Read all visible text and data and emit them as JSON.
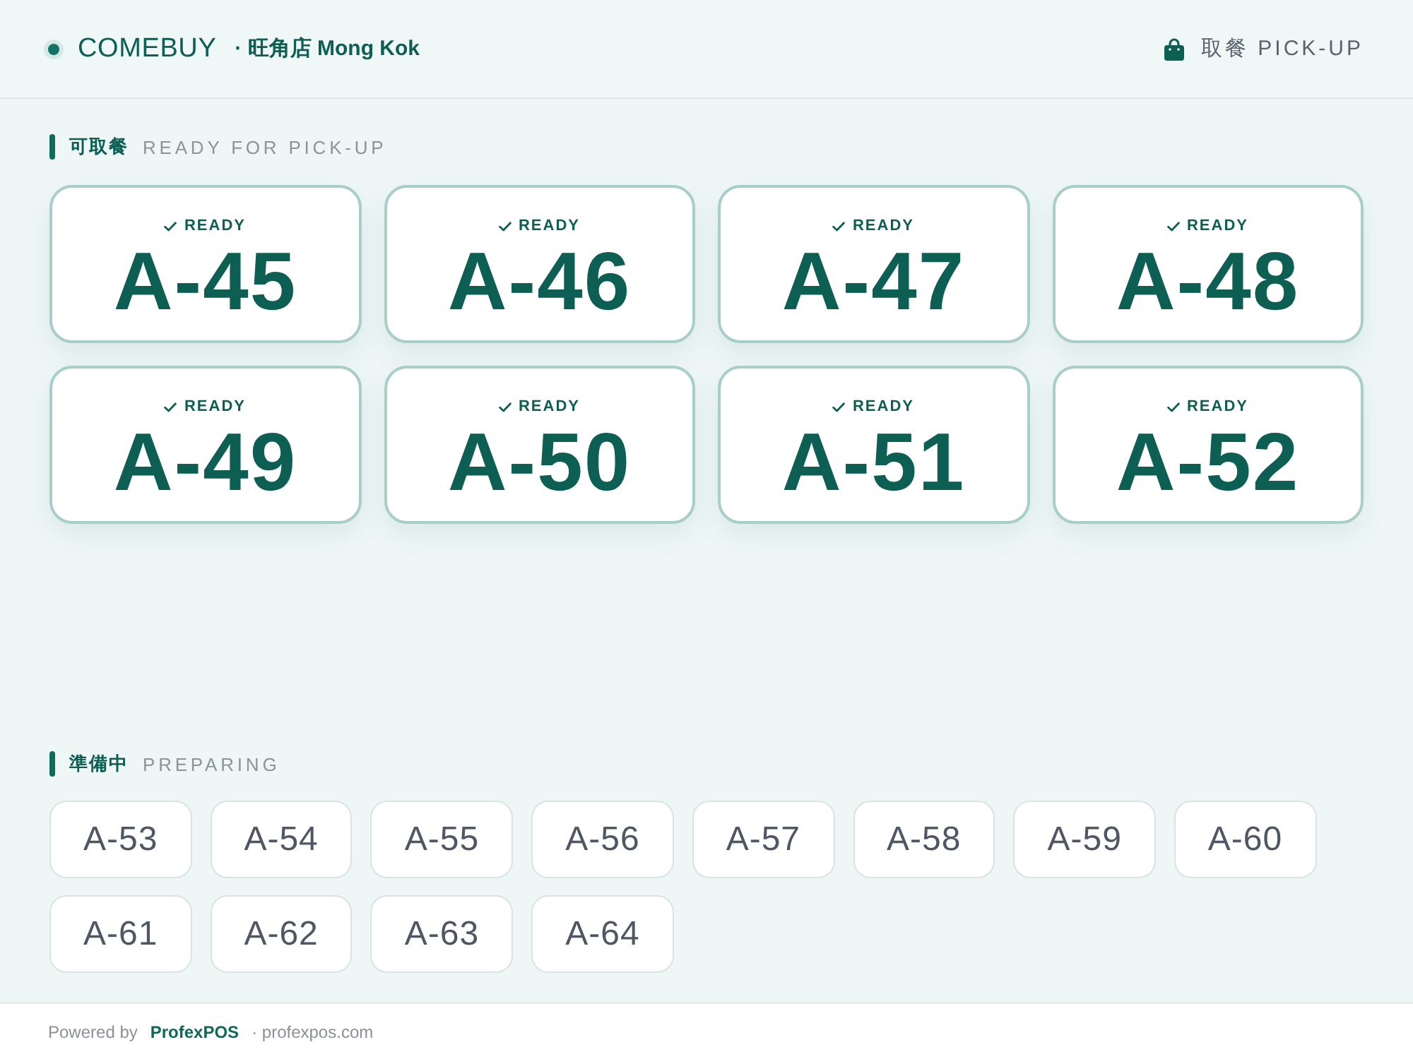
{
  "header": {
    "brand": "COMEBUY",
    "store": "· 旺角店 Mong Kok",
    "pickup": "取餐 PICK-UP"
  },
  "ready_section": {
    "title_zh": "可取餐",
    "title_en": "READY FOR PICK-UP",
    "orders": [
      {
        "label": "READY",
        "number": "A-45"
      },
      {
        "label": "READY",
        "number": "A-46"
      },
      {
        "label": "READY",
        "number": "A-47"
      },
      {
        "label": "READY",
        "number": "A-48"
      },
      {
        "label": "READY",
        "number": "A-49"
      },
      {
        "label": "READY",
        "number": "A-50"
      },
      {
        "label": "READY",
        "number": "A-51"
      },
      {
        "label": "READY",
        "number": "A-52"
      }
    ]
  },
  "preparing_section": {
    "title_zh": "準備中",
    "title_en": "PREPARING",
    "orders": [
      "A-53",
      "A-54",
      "A-55",
      "A-56",
      "A-57",
      "A-58",
      "A-59",
      "A-60",
      "A-61",
      "A-62",
      "A-63",
      "A-64"
    ]
  },
  "footer": {
    "powered_by": "Powered by",
    "brand": "ProfexPOS",
    "site": "· profexpos.com"
  }
}
